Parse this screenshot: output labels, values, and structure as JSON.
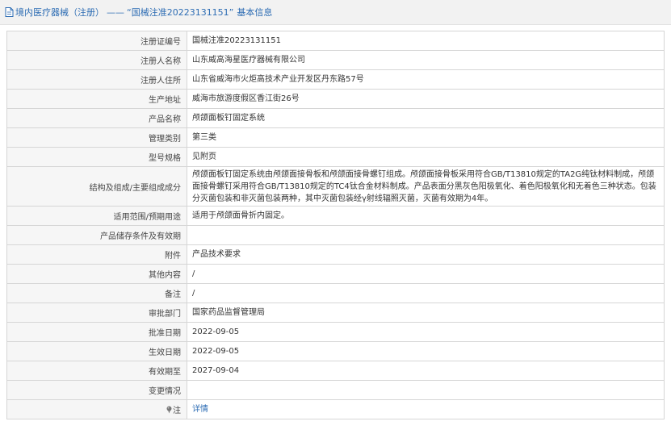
{
  "header": {
    "category": "境内医疗器械（注册）",
    "separator": "——",
    "record_title": "“国械注准20223131151”",
    "suffix": "基本信息"
  },
  "rows": [
    {
      "label": "注册证编号",
      "value": "国械注准20223131151"
    },
    {
      "label": "注册人名称",
      "value": "山东威高海星医疗器械有限公司"
    },
    {
      "label": "注册人住所",
      "value": "山东省威海市火炬高技术产业开发区丹东路57号"
    },
    {
      "label": "生产地址",
      "value": "威海市旅游度假区香江街26号"
    },
    {
      "label": "产品名称",
      "value": "颅颌面板钉固定系统"
    },
    {
      "label": "管理类别",
      "value": "第三类"
    },
    {
      "label": "型号规格",
      "value": "见附页"
    },
    {
      "label": "结构及组成/主要组成成分",
      "value": "颅颌面板钉固定系统由颅颌面接骨板和颅颌面接骨螺钉组成。颅颌面接骨板采用符合GB/T13810规定的TA2G纯钛材料制成，颅颌面接骨螺钉采用符合GB/T13810规定的TC4钛合金材料制成。产品表面分黑灰色阳极氧化、着色阳极氧化和无着色三种状态。包装分灭菌包装和非灭菌包装两种，其中灭菌包装经γ射线辐照灭菌，灭菌有效期为4年。"
    },
    {
      "label": "适用范围/预期用途",
      "value": "适用于颅颌面骨折内固定。"
    },
    {
      "label": "产品储存条件及有效期",
      "value": ""
    },
    {
      "label": "附件",
      "value": "产品技术要求"
    },
    {
      "label": "其他内容",
      "value": "/"
    },
    {
      "label": "备注",
      "value": "/"
    },
    {
      "label": "审批部门",
      "value": "国家药品监督管理局"
    },
    {
      "label": "批准日期",
      "value": "2022-09-05"
    },
    {
      "label": "生效日期",
      "value": "2022-09-05"
    },
    {
      "label": "有效期至",
      "value": "2027-09-04"
    },
    {
      "label": "变更情况",
      "value": ""
    },
    {
      "label": "注",
      "value": "详情"
    }
  ]
}
